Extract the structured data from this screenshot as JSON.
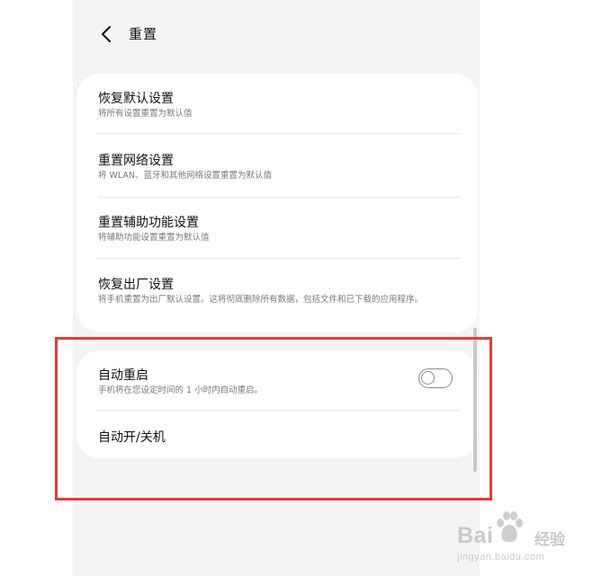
{
  "header": {
    "title": "重置"
  },
  "reset_card": {
    "items": [
      {
        "title": "恢复默认设置",
        "subtitle": "将所有设置重置为默认值"
      },
      {
        "title": "重置网络设置",
        "subtitle": "将 WLAN、蓝牙和其他网络设置重置为默认值"
      },
      {
        "title": "重置辅助功能设置",
        "subtitle": "将辅助功能设置重置为默认值"
      },
      {
        "title": "恢复出厂设置",
        "subtitle": "将手机重置为出厂默认设置。这将彻底删除所有数据，包括文件和已下载的应用程序。"
      }
    ]
  },
  "auto_card": {
    "auto_restart": {
      "title": "自动重启",
      "subtitle": "手机将在您设定时间的 1 小时内自动重启。",
      "toggle_on": false
    },
    "auto_power": {
      "title": "自动开/关机"
    }
  },
  "watermark": {
    "brand_prefix": "Bai",
    "brand_suffix": "经验",
    "url": "jingyan.baidu.com"
  },
  "colors": {
    "highlight_border": "#e63b3b",
    "background": "#f4f4f4",
    "card": "#ffffff"
  },
  "icons": {
    "back": "chevron-left-icon",
    "toggle": "toggle-switch-off",
    "watermark_logo": "baidu-paw-icon"
  }
}
